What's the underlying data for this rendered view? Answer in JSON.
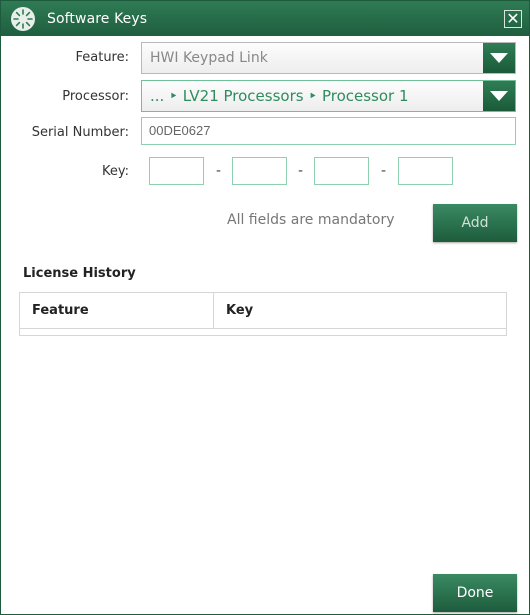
{
  "window": {
    "title": "Software Keys"
  },
  "form": {
    "feature_label": "Feature:",
    "feature_value": "HWI Keypad Link",
    "processor_label": "Processor:",
    "processor_value": "... ‣ LV21 Processors ‣ Processor 1",
    "serial_label": "Serial Number:",
    "serial_value": "00DE0627",
    "key_label": "Key:",
    "key_parts": [
      "",
      "",
      "",
      ""
    ],
    "key_separator": "-",
    "mandatory_note": "All fields are mandatory",
    "add_label": "Add"
  },
  "history": {
    "title": "License History",
    "columns": [
      "Feature",
      "Key"
    ],
    "rows": []
  },
  "footer": {
    "done_label": "Done"
  },
  "colors": {
    "accent": "#1f5e3f",
    "border_green": "#8fd0b0",
    "processor_text": "#2e8c5e"
  },
  "icons": {
    "app": "sunburst-icon",
    "close": "close-icon",
    "dropdown": "chevron-down-icon"
  }
}
